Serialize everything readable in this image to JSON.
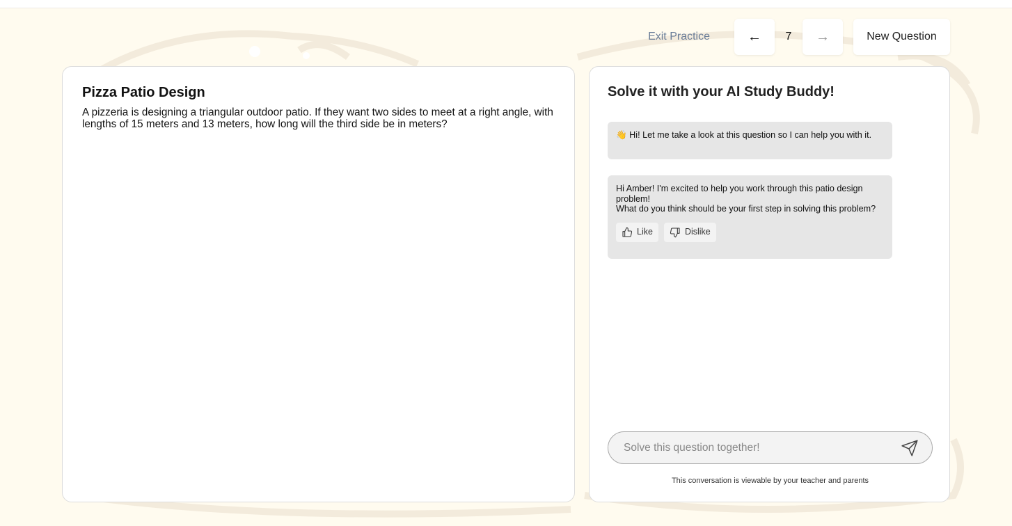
{
  "toolbar": {
    "exit_label": "Exit Practice",
    "prev_icon": "←",
    "page_number": "7",
    "next_icon": "→",
    "new_question_label": "New Question"
  },
  "question": {
    "title": "Pizza Patio Design",
    "body": "A pizzeria is designing a triangular outdoor patio. If they want two sides to meet at a right angle, with lengths of 15 meters and 13 meters, how long will the third side be in meters?"
  },
  "chat": {
    "title": "Solve it with your AI Study Buddy!",
    "messages": [
      {
        "lines": [
          "👋 Hi! Let me take a look at this question so I can help you with it."
        ]
      },
      {
        "lines": [
          "Hi Amber! I'm excited to help you work through this patio design problem!",
          "What do you think should be your first step in solving this problem?"
        ]
      }
    ],
    "like_label": "Like",
    "dislike_label": "Dislike",
    "input_placeholder": "Solve this question together!",
    "disclaimer": "This conversation is viewable by your teacher and parents"
  },
  "colors": {
    "background": "#fffbef",
    "bubble": "#e6e6e6",
    "link": "#6a7d98"
  }
}
